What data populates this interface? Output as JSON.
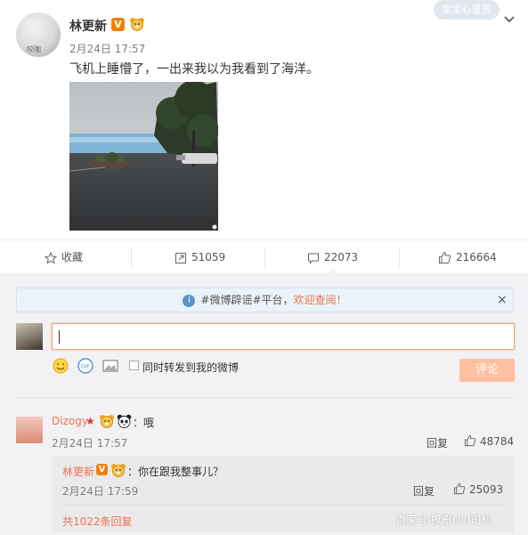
{
  "post": {
    "avatar_watermark": "咬咖",
    "username": "林更新",
    "verified_badge": "V",
    "time": "2月24日 17:57",
    "text": "飞机上睡懵了，一出来我以为我看到了海洋。",
    "top_watermark": "宝宝心里苦"
  },
  "actions": {
    "favorite_label": "收藏",
    "repost_count": "51059",
    "comment_count": "22073",
    "like_count": "216664"
  },
  "notice": {
    "prefix": "#微博辟谣#平台，",
    "highlight": "欢迎查阅！",
    "close": "×"
  },
  "composer": {
    "input_value": "",
    "sync_label": "同时转发到我的微博",
    "submit_label": "评论"
  },
  "comments": [
    {
      "username": "Dizogy",
      "text": "：哦",
      "time": "2月24日 17:57",
      "reply_label": "回复",
      "likes": "48784",
      "replies": [
        {
          "username": "林更新",
          "badge": "V",
          "text": "：你在跟我整事儿？",
          "time": "2月24日 17:59",
          "reply_label": "回复",
          "likes": "25093"
        }
      ],
      "more_replies": "共1022条回复"
    }
  ],
  "bottom_watermark": "百家号/撩剧Old司机",
  "colors": {
    "accent_orange": "#eb7350",
    "verified_orange": "#f08200",
    "submit_disabled": "#ffc09f"
  }
}
